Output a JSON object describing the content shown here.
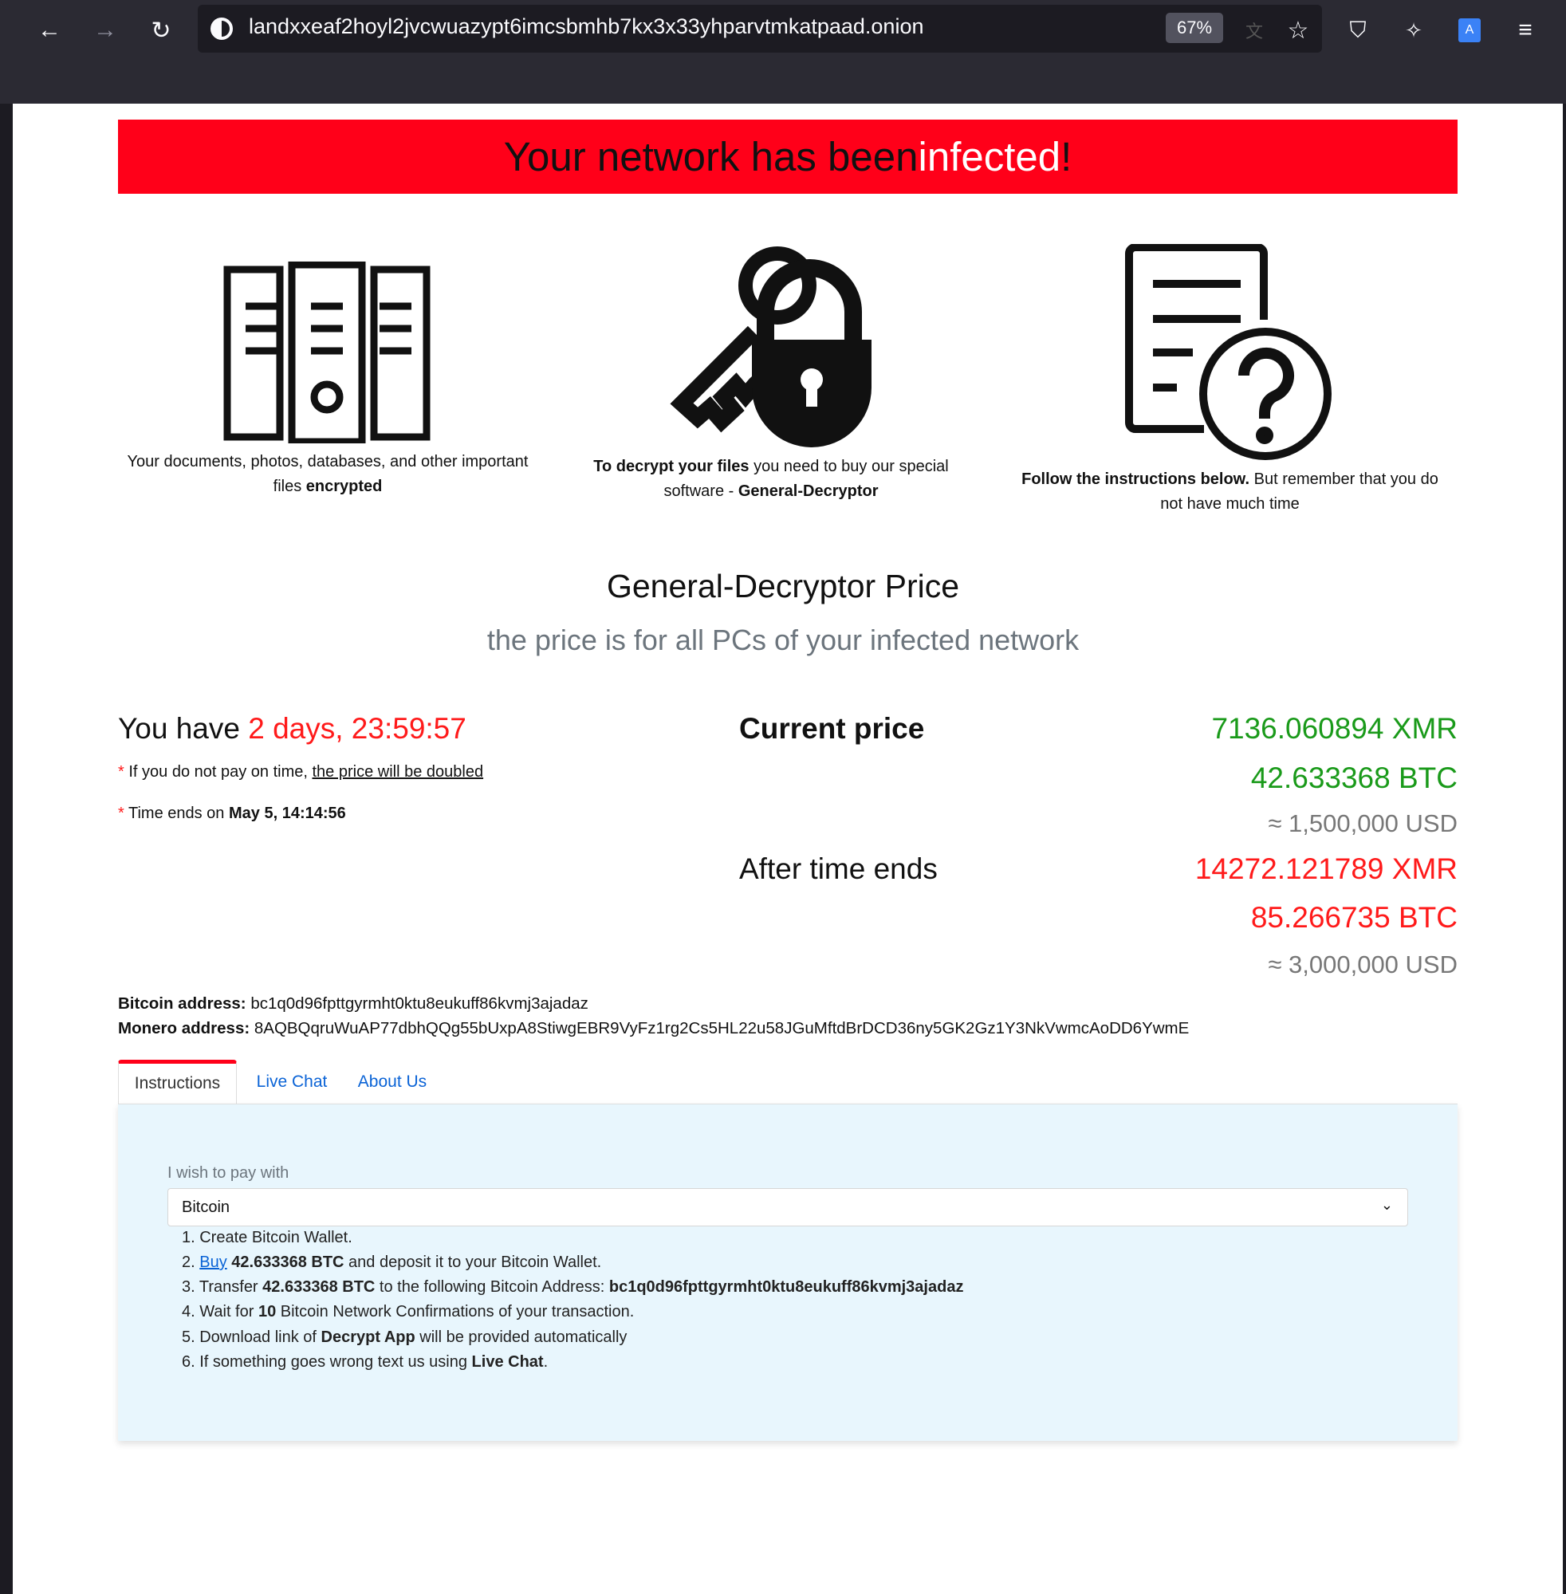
{
  "browser": {
    "url": "landxxeaf2hoyl2jvcwuazypt6imcsbmhb7kx3x33yhparvtmkatpaad.onion",
    "zoom": "67%"
  },
  "banner": {
    "part1": "Your network has been ",
    "part2": "infected",
    "part3": "!"
  },
  "features": [
    {
      "icon": "files-icon",
      "text1": "Your documents, photos, databases, and other important files ",
      "bold": "encrypted"
    },
    {
      "icon": "key-lock-icon",
      "bold1": "To decrypt your files",
      "text1": " you need to buy our special software - ",
      "bold2": "General-Decryptor"
    },
    {
      "icon": "document-question-icon",
      "bold1": "Follow the instructions below.",
      "text1": " But remember that you do not have much time"
    }
  ],
  "price": {
    "title": "General-Decryptor Price",
    "subtitle": "the price is for all PCs of your infected network"
  },
  "timer": {
    "prefix": "You have ",
    "value": "2 days, 23:59:57",
    "note1_prefix": "If you do not pay on time, ",
    "note1_link": "the price will be doubled",
    "note2_prefix": "Time ends on ",
    "note2_bold": "May 5, 14:14:56",
    "star": "*"
  },
  "current": {
    "label": "Current price",
    "xmr": "7136.060894 XMR",
    "btc": "42.633368 BTC",
    "usd": "≈ 1,500,000 USD"
  },
  "after": {
    "label": "After time ends",
    "xmr": "14272.121789 XMR",
    "btc": "85.266735 BTC",
    "usd": "≈ 3,000,000 USD"
  },
  "addresses": {
    "btc_label": "Bitcoin address:",
    "btc": " bc1q0d96fpttgyrmht0ktu8eukuff86kvmj3ajadaz",
    "xmr_label": "Monero address:",
    "xmr": " 8AQBQqruWuAP77dbhQQg55bUxpA8StiwgEBR9VyFz1rg2Cs5HL22u58JGuMftdBrDCD36ny5GK2Gz1Y3NkVwmcAoDD6YwmE"
  },
  "tabs": [
    {
      "label": "Instructions",
      "active": true
    },
    {
      "label": "Live Chat"
    },
    {
      "label": "About Us"
    }
  ],
  "pay": {
    "label": "I wish to pay with",
    "selected": "Bitcoin"
  },
  "steps": {
    "s1": "1. Create Bitcoin Wallet.",
    "s2a": "2. ",
    "s2link": "Buy",
    "s2b": " 42.633368 BTC",
    "s2c": " and deposit it to your Bitcoin Wallet.",
    "s3a": "3. Transfer ",
    "s3b": "42.633368 BTC",
    "s3c": " to the following Bitcoin Address: ",
    "s3d": "bc1q0d96fpttgyrmht0ktu8eukuff86kvmj3ajadaz",
    "s4a": "4. Wait for ",
    "s4b": "10",
    "s4c": " Bitcoin Network Confirmations of your transaction.",
    "s5a": "5. Download link of ",
    "s5b": "Decrypt App",
    "s5c": " will be provided automatically",
    "s6a": "6. If something goes wrong text us using ",
    "s6b": "Live Chat",
    "s6c": "."
  },
  "colors": {
    "banner": "#ff0019",
    "green": "#1a9a1a",
    "red": "#ff1a1a",
    "panel": "#e8f6fd",
    "link": "#0a63d6"
  }
}
